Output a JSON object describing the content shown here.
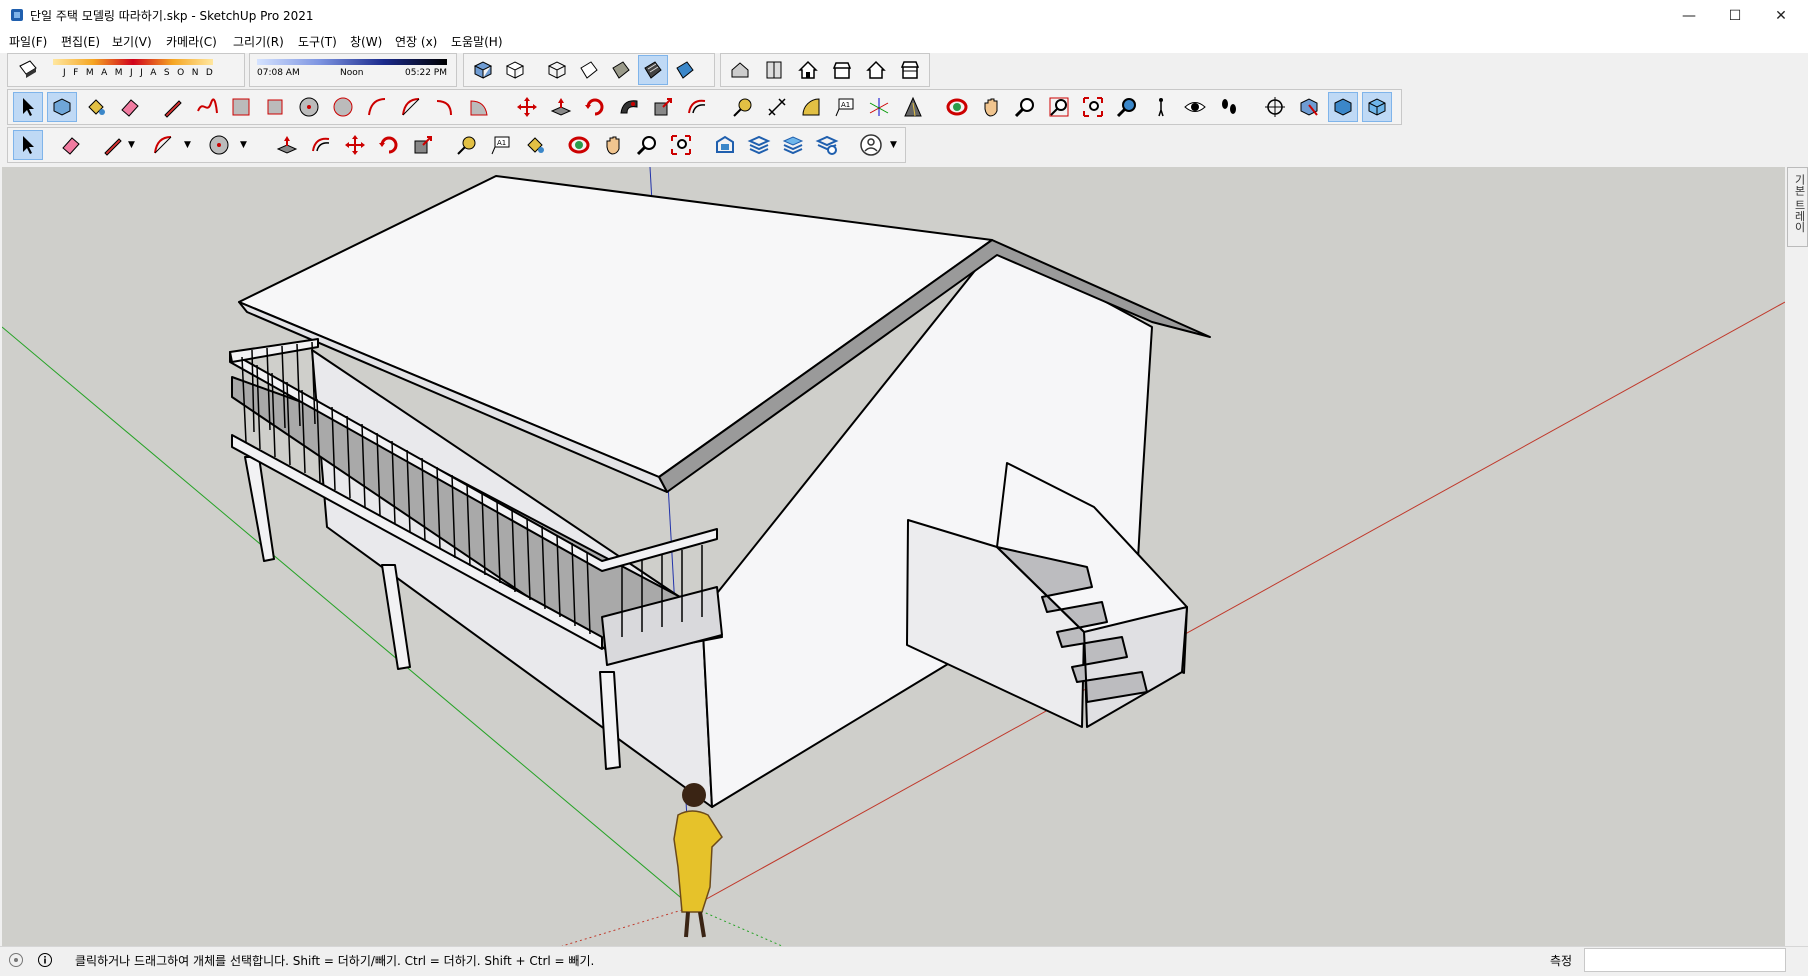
{
  "window": {
    "title": "단일 주택 모델링 따라하기.skp - SketchUp Pro 2021",
    "minimize": "—",
    "maximize": "☐",
    "close": "✕"
  },
  "menu": [
    {
      "label": "파일(F)"
    },
    {
      "label": "편집(E)"
    },
    {
      "label": "보기(V)"
    },
    {
      "label": "카메라(C)"
    },
    {
      "label": "그리기(R)"
    },
    {
      "label": "도구(T)"
    },
    {
      "label": "창(W)"
    },
    {
      "label": "연장 (x)"
    },
    {
      "label": "도움말(H)"
    }
  ],
  "shadow": {
    "months": [
      "J",
      "F",
      "M",
      "A",
      "M",
      "J",
      "J",
      "A",
      "S",
      "O",
      "N",
      "D"
    ],
    "time_start": "07:08 AM",
    "time_noon": "Noon",
    "time_end": "05:22 PM"
  },
  "tray": {
    "label": "기본 트레이"
  },
  "status": {
    "message": "클릭하거나 드래그하여 개체를 선택합니다. Shift = 더하기/빼기. Ctrl = 더하기. Shift + Ctrl = 빼기.",
    "measure_label": "측정",
    "measure_value": ""
  },
  "colors": {
    "viewport_bg": "#cfcfcb",
    "axis_red": "#c0392b",
    "axis_green": "#27a327",
    "axis_blue": "#2233aa",
    "active_tool": "#bfd9f5"
  }
}
